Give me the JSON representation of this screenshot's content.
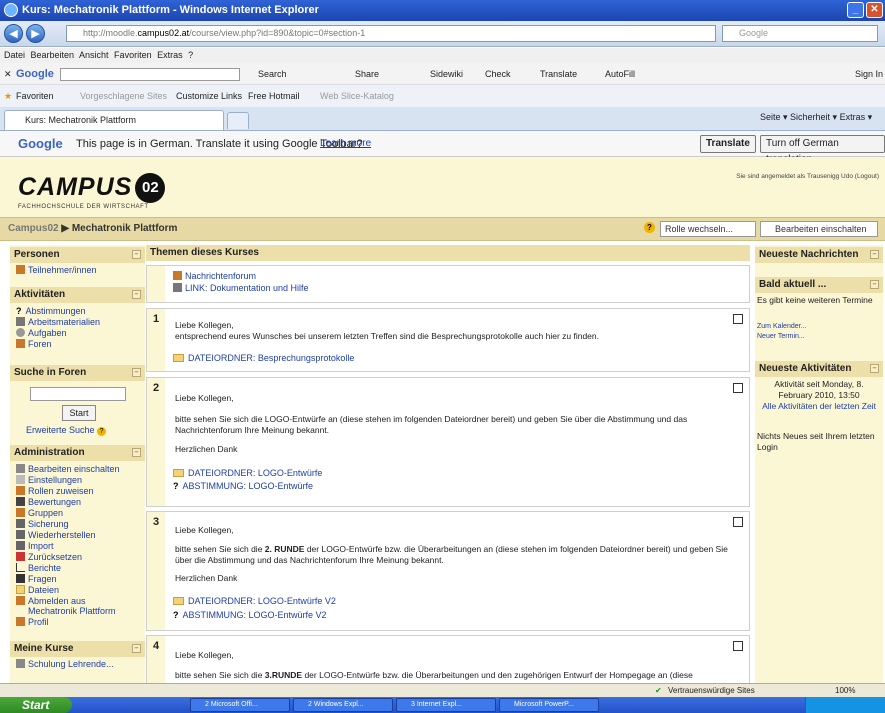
{
  "window": {
    "title": "Kurs: Mechatronik Plattform - Windows Internet Explorer"
  },
  "address": {
    "url_prefix": "http://moodle.",
    "url_host": "campus02.at",
    "url_rest": "/course/view.php?id=890&topic=0#section-1",
    "search_placeholder": "Google"
  },
  "menu": {
    "items": "Datei  Bearbeiten  Ansicht  Favoriten  Extras  ?"
  },
  "google_toolbar": {
    "label": "Google",
    "search": "Search",
    "share": "Share",
    "sidewiki": "Sidewiki",
    "check": "Check",
    "translate": "Translate",
    "autofill": "AutoFill",
    "signin": "Sign In"
  },
  "favbar": {
    "favoriten": "Favoriten",
    "suggested": "Vorgeschlagene Sites",
    "customize": "Customize Links",
    "hotmail": "Free Hotmail",
    "slice": "Web Slice-Katalog"
  },
  "tabs": {
    "active": "Kurs: Mechatronik Plattform",
    "cmd": "Seite ▾   Sicherheit ▾   Extras ▾"
  },
  "translate_bar": {
    "message": "This page is in German.  Translate it using Google Toolbar?",
    "learn": "Learn more",
    "btn_translate": "Translate",
    "btn_off": "Turn off German translation"
  },
  "header": {
    "logo_text": "CAMPUS",
    "logo_num": "02",
    "logo_sub": "FACHHOCHSCHULE DER WIRTSCHAFT",
    "login_info": "Sie sind angemeldet als Trausenigg Udo (Logout)"
  },
  "navbar": {
    "home": "Campus02",
    "sep": "▶",
    "course": "Mechatronik Plattform",
    "rolle": "Rolle wechseln...",
    "bearbeiten": "Bearbeiten einschalten"
  },
  "left": {
    "personen": "Personen",
    "teilnehmer": "Teilnehmer/innen",
    "aktivitaeten": "Aktivitäten",
    "act": [
      "Abstimmungen",
      "Arbeitsmaterialien",
      "Aufgaben",
      "Foren"
    ],
    "suche": "Suche in Foren",
    "start": "Start",
    "erweitert": "Erweiterte Suche",
    "admin": "Administration",
    "adm": [
      "Bearbeiten einschalten",
      "Einstellungen",
      "Rollen zuweisen",
      "Bewertungen",
      "Gruppen",
      "Sicherung",
      "Wiederherstellen",
      "Import",
      "Zurücksetzen",
      "Berichte",
      "Fragen",
      "Dateien",
      "Abmelden aus",
      "Mechatronik Plattform",
      "Profil"
    ],
    "meine": "Meine Kurse",
    "meine_item": "Schulung Lehrende..."
  },
  "center": {
    "title": "Themen dieses Kurses",
    "s0": {
      "l1": "Nachrichtenforum",
      "l2": "LINK: Dokumentation und Hilfe"
    },
    "s1": {
      "num": "1",
      "t1": "Liebe Kollegen,",
      "t2": "entsprechend eures Wunsches bei unserem letzten Treffen sind die Besprechungsprotokolle auch hier zu finden.",
      "l1": "DATEIORDNER: Besprechungsprotokolle"
    },
    "s2": {
      "num": "2",
      "t1": "Liebe Kollegen,",
      "t2": "bitte sehen Sie sich die LOGO-Entwürfe an (diese stehen im folgenden Dateiordner bereit) und geben Sie über die Abstimmung und das Nachrichtenforum Ihre Meinung bekannt.",
      "t3": "Herzlichen Dank",
      "l1": "DATEIORDNER: LOGO-Entwürfe",
      "l2": "ABSTIMMUNG: LOGO-Entwürfe"
    },
    "s3": {
      "num": "3",
      "t1": "Liebe Kollegen,",
      "t2a": "bitte sehen Sie sich die ",
      "t2b": "2. RUNDE",
      "t2c": " der LOGO-Entwürfe bzw. die Überarbeitungen an (diese stehen im folgenden Dateiordner bereit) und geben Sie über die Abstimmung und das Nachrichtenforum Ihre Meinung bekannt.",
      "t3": "Herzlichen Dank",
      "l1": "DATEIORDNER: LOGO-Entwürfe V2",
      "l2": "ABSTIMMUNG: LOGO-Entwürfe V2"
    },
    "s4": {
      "num": "4",
      "t1": "Liebe Kollegen,",
      "t2a": "bitte sehen Sie sich die ",
      "t2b": "3.RUNDE",
      "t2c": " der LOGO-Entwürfe bzw. die Überarbeitungen und den zugehörigen Entwurf der Hompegage an (diese"
    }
  },
  "right": {
    "news": "Neueste Nachrichten",
    "bald": "Bald aktuell ...",
    "bald_text": "Es gibt keine weiteren Termine",
    "kal": "Zum Kalender...",
    "neu": "Neuer Termin...",
    "akt": "Neueste Aktivitäten",
    "akt_text": "Aktivität seit Monday, 8. February 2010, 13:50",
    "akt_link": "Alle Aktivitäten der letzten Zeit",
    "nichts": "Nichts Neues seit Ihrem letzten Login"
  },
  "status": {
    "trusted": "Vertrauenswürdige Sites",
    "zoom": "100%"
  },
  "taskbar": {
    "start": "Start",
    "items": [
      "2 Microsoft Offi...",
      "2 Windows Expl...",
      "3 Internet Expl...",
      "Microsoft PowerP..."
    ]
  }
}
